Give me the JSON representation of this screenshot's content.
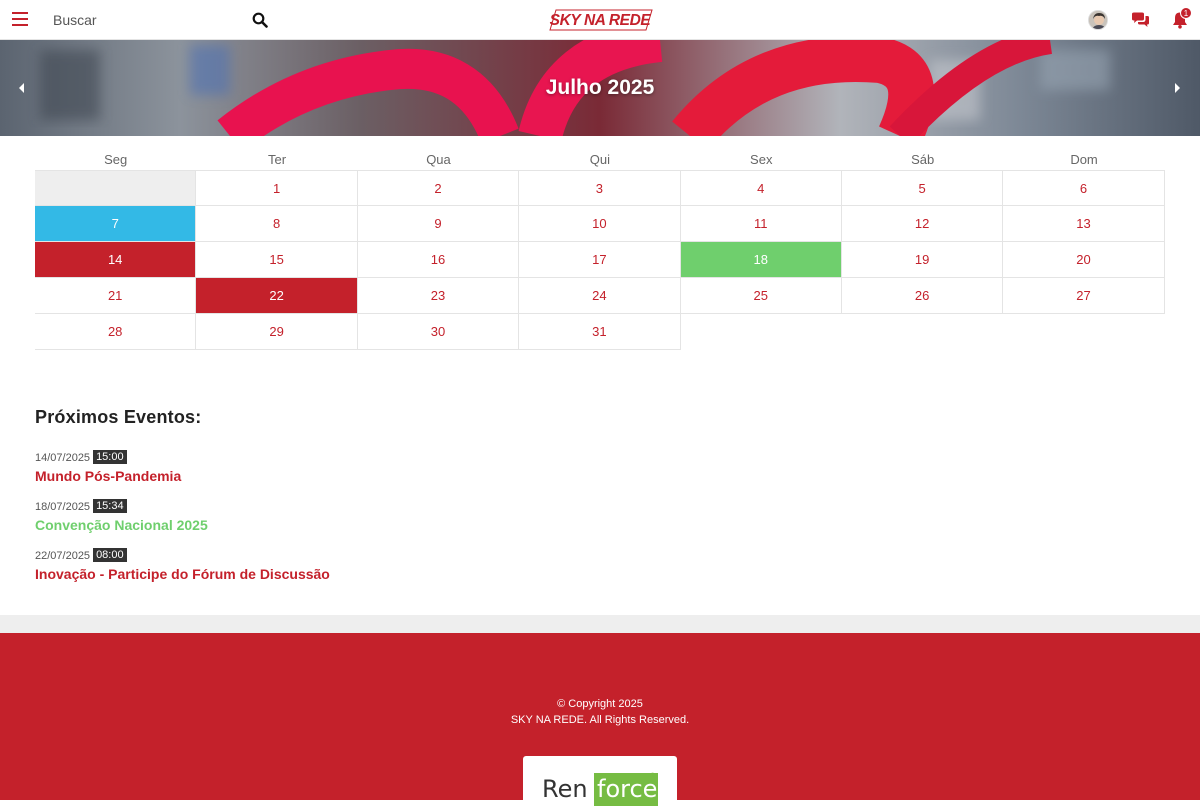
{
  "header": {
    "search_placeholder": "Buscar",
    "logo_text": "SKY NA REDE",
    "notification_count": "1",
    "brand_color": "#c4212b"
  },
  "banner": {
    "title": "Julho 2025"
  },
  "calendar": {
    "weekdays": [
      "Seg",
      "Ter",
      "Qua",
      "Qui",
      "Sex",
      "Sáb",
      "Dom"
    ],
    "weeks": [
      [
        {
          "day": "",
          "style": "empty"
        },
        {
          "day": "1"
        },
        {
          "day": "2"
        },
        {
          "day": "3"
        },
        {
          "day": "4"
        },
        {
          "day": "5"
        },
        {
          "day": "6"
        }
      ],
      [
        {
          "day": "7",
          "style": "blue"
        },
        {
          "day": "8"
        },
        {
          "day": "9"
        },
        {
          "day": "10"
        },
        {
          "day": "11"
        },
        {
          "day": "12"
        },
        {
          "day": "13"
        }
      ],
      [
        {
          "day": "14",
          "style": "red"
        },
        {
          "day": "15"
        },
        {
          "day": "16"
        },
        {
          "day": "17"
        },
        {
          "day": "18",
          "style": "green"
        },
        {
          "day": "19"
        },
        {
          "day": "20"
        }
      ],
      [
        {
          "day": "21"
        },
        {
          "day": "22",
          "style": "red"
        },
        {
          "day": "23"
        },
        {
          "day": "24"
        },
        {
          "day": "25"
        },
        {
          "day": "26"
        },
        {
          "day": "27"
        }
      ],
      [
        {
          "day": "28"
        },
        {
          "day": "29"
        },
        {
          "day": "30"
        },
        {
          "day": "31"
        },
        {
          "day": "",
          "style": "blank"
        },
        {
          "day": "",
          "style": "blank"
        },
        {
          "day": "",
          "style": "blank"
        }
      ]
    ],
    "colors": {
      "blue": "#33b9e6",
      "red": "#c4212b",
      "green": "#6fcf6d"
    }
  },
  "events": {
    "title": "Próximos Eventos:",
    "items": [
      {
        "date": "14/07/2025",
        "time": "15:00",
        "name": "Mundo Pós-Pandemia",
        "color": "#c4212b"
      },
      {
        "date": "18/07/2025",
        "time": "15:34",
        "name": "Convenção Nacional 2025",
        "color": "#6fcf6d"
      },
      {
        "date": "22/07/2025",
        "time": "08:00",
        "name": "Inovação - Participe do Fórum de Discussão",
        "color": "#c4212b"
      }
    ]
  },
  "footer": {
    "copyright_line1": "© Copyright 2025",
    "copyright_line2": "SKY NA REDE. All Rights Reserved.",
    "partner_ren": "Ren",
    "partner_force": "force",
    "partner_reg": "®"
  }
}
